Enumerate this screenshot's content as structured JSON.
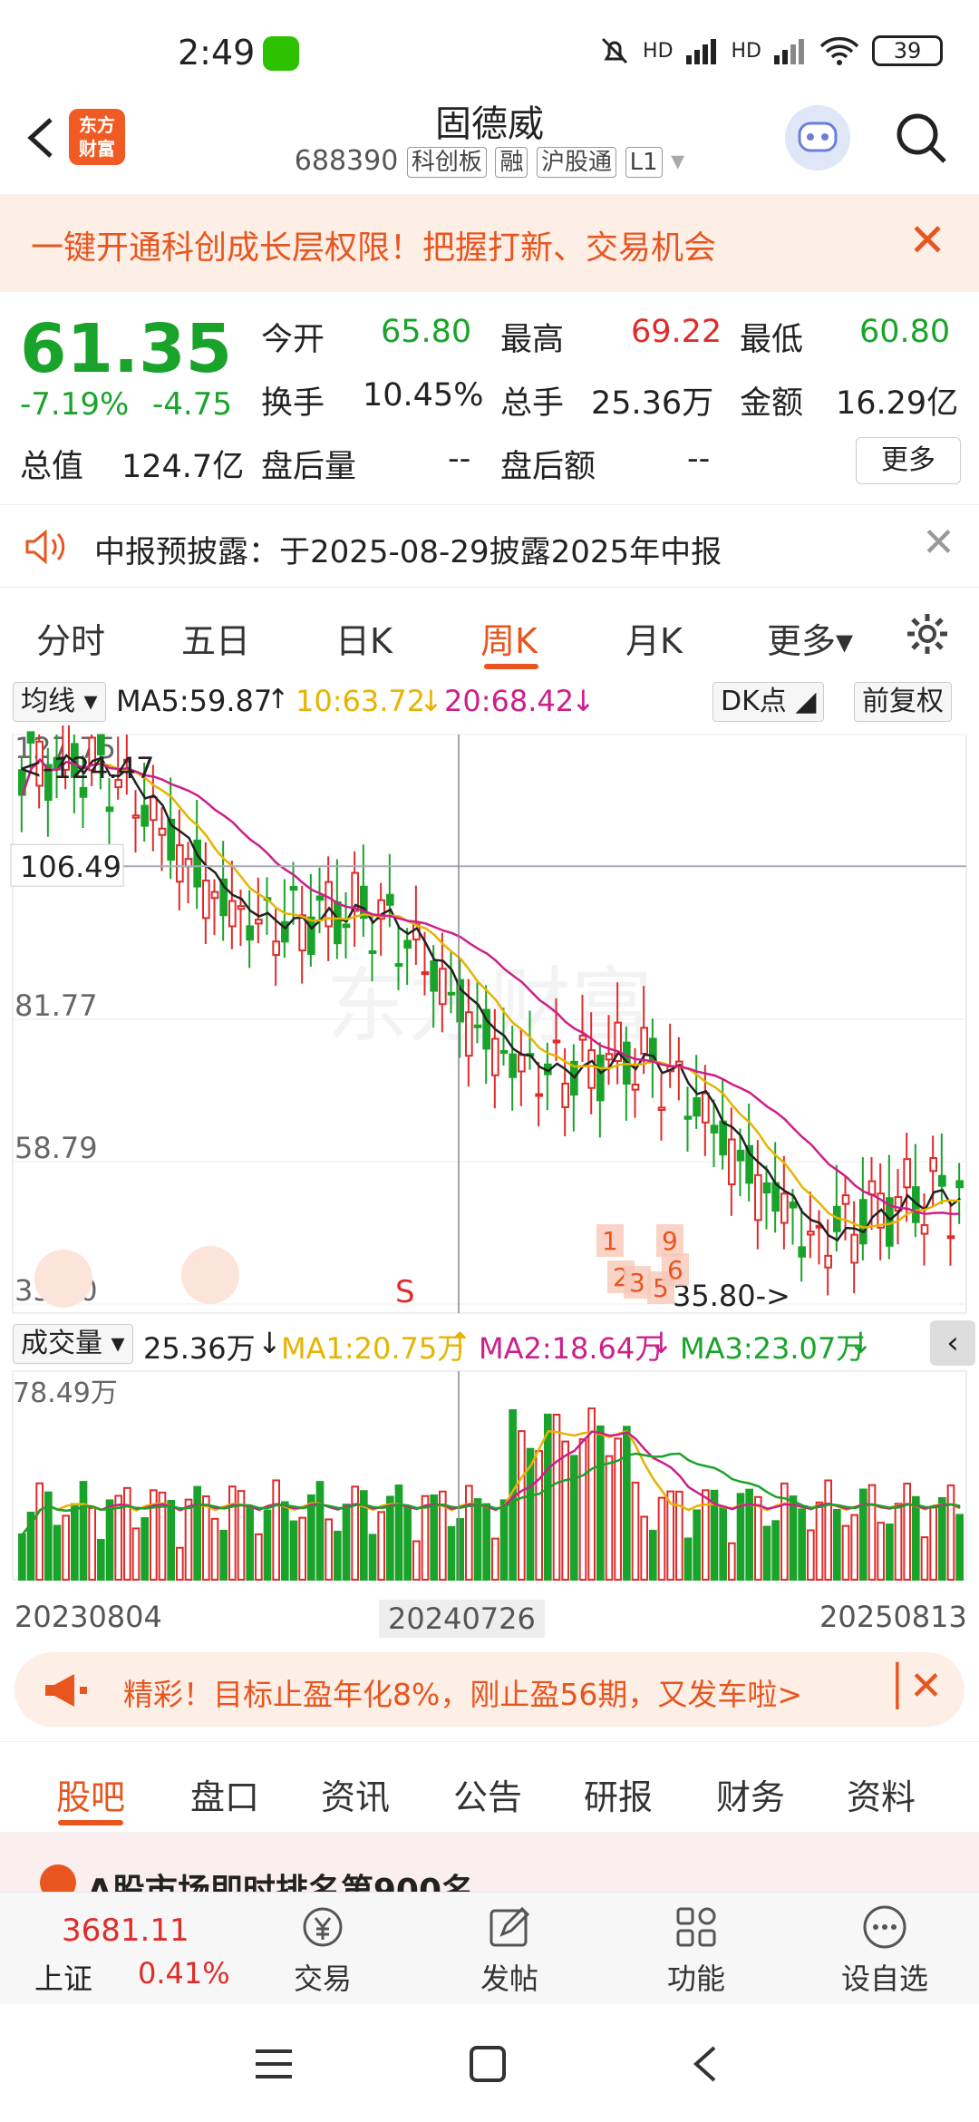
{
  "status": {
    "time": "2:49",
    "battery": "39",
    "signal1": "HD",
    "signal2": "HD"
  },
  "header": {
    "logo_text": "东方\n财富",
    "title": "固德威",
    "code": "688390",
    "tags": [
      "科创板",
      "融",
      "沪股通",
      "L1"
    ]
  },
  "banner": {
    "text": "一键开通科创成长层权限！把握打新、交易机会"
  },
  "quote": {
    "price": "61.35",
    "change_pct": "-7.19%",
    "change": "-4.75",
    "open_label": "今开",
    "open": "65.80",
    "high_label": "最高",
    "high": "69.22",
    "low_label": "最低",
    "low": "60.80",
    "turnover_label": "换手",
    "turnover": "10.45%",
    "volume_label": "总手",
    "volume": "25.36万",
    "amount_label": "金额",
    "amount": "16.29亿",
    "mktcap_label": "总值",
    "mktcap": "124.7亿",
    "after_vol_label": "盘后量",
    "after_vol": "--",
    "after_amt_label": "盘后额",
    "after_amt": "--",
    "more": "更多"
  },
  "notice": {
    "text": "中报预披露：于2025-08-29披露2025年中报"
  },
  "tabs": [
    "分时",
    "五日",
    "日K",
    "周K",
    "月K",
    "更多▾"
  ],
  "ma": {
    "selector": "均线",
    "ma5": "MA5:59.87",
    "ma10": "10:63.72",
    "ma20": "20:68.42",
    "dk": "DK点",
    "adjust": "前复权"
  },
  "chart_data": {
    "type": "candlestick",
    "period": "weekly",
    "y_labels": [
      "127.75",
      "81.77",
      "58.79",
      "35.80"
    ],
    "ylim": [
      35.8,
      127.75
    ],
    "max_marker": "<-124.47",
    "min_marker": "35.80->",
    "crosshair_price": "106.49",
    "x_labels": [
      "20230804",
      "20240726",
      "20250813"
    ],
    "watermark": "东方财富",
    "signals": [
      "S",
      "1",
      "9",
      "2",
      "3",
      "5",
      "6",
      "9"
    ],
    "ma_colors": {
      "ma5": "#222222",
      "ma10": "#e6b400",
      "ma20": "#cc1f8a"
    },
    "volume": {
      "label": "成交量",
      "value": "25.36万",
      "ma1": "MA1:20.75万",
      "ma2": "MA2:18.64万",
      "ma3": "MA3:23.07万",
      "ymax_label": "78.49万",
      "colors": {
        "ma1": "#e6b400",
        "ma2": "#cc1f8a",
        "ma3": "#1aa32a"
      }
    }
  },
  "promo": {
    "text": "精彩！目标止盈年化8%，刚止盈56期，又发车啦>"
  },
  "bottom_tabs": [
    "股吧",
    "盘口",
    "资讯",
    "公告",
    "研报",
    "财务",
    "资料"
  ],
  "rank": {
    "text": "A股市场即时排名第900名"
  },
  "nav": {
    "index_value": "3681.11",
    "index_name": "上证",
    "index_change": "0.41%",
    "items": [
      "交易",
      "发帖",
      "功能",
      "设自选"
    ]
  }
}
